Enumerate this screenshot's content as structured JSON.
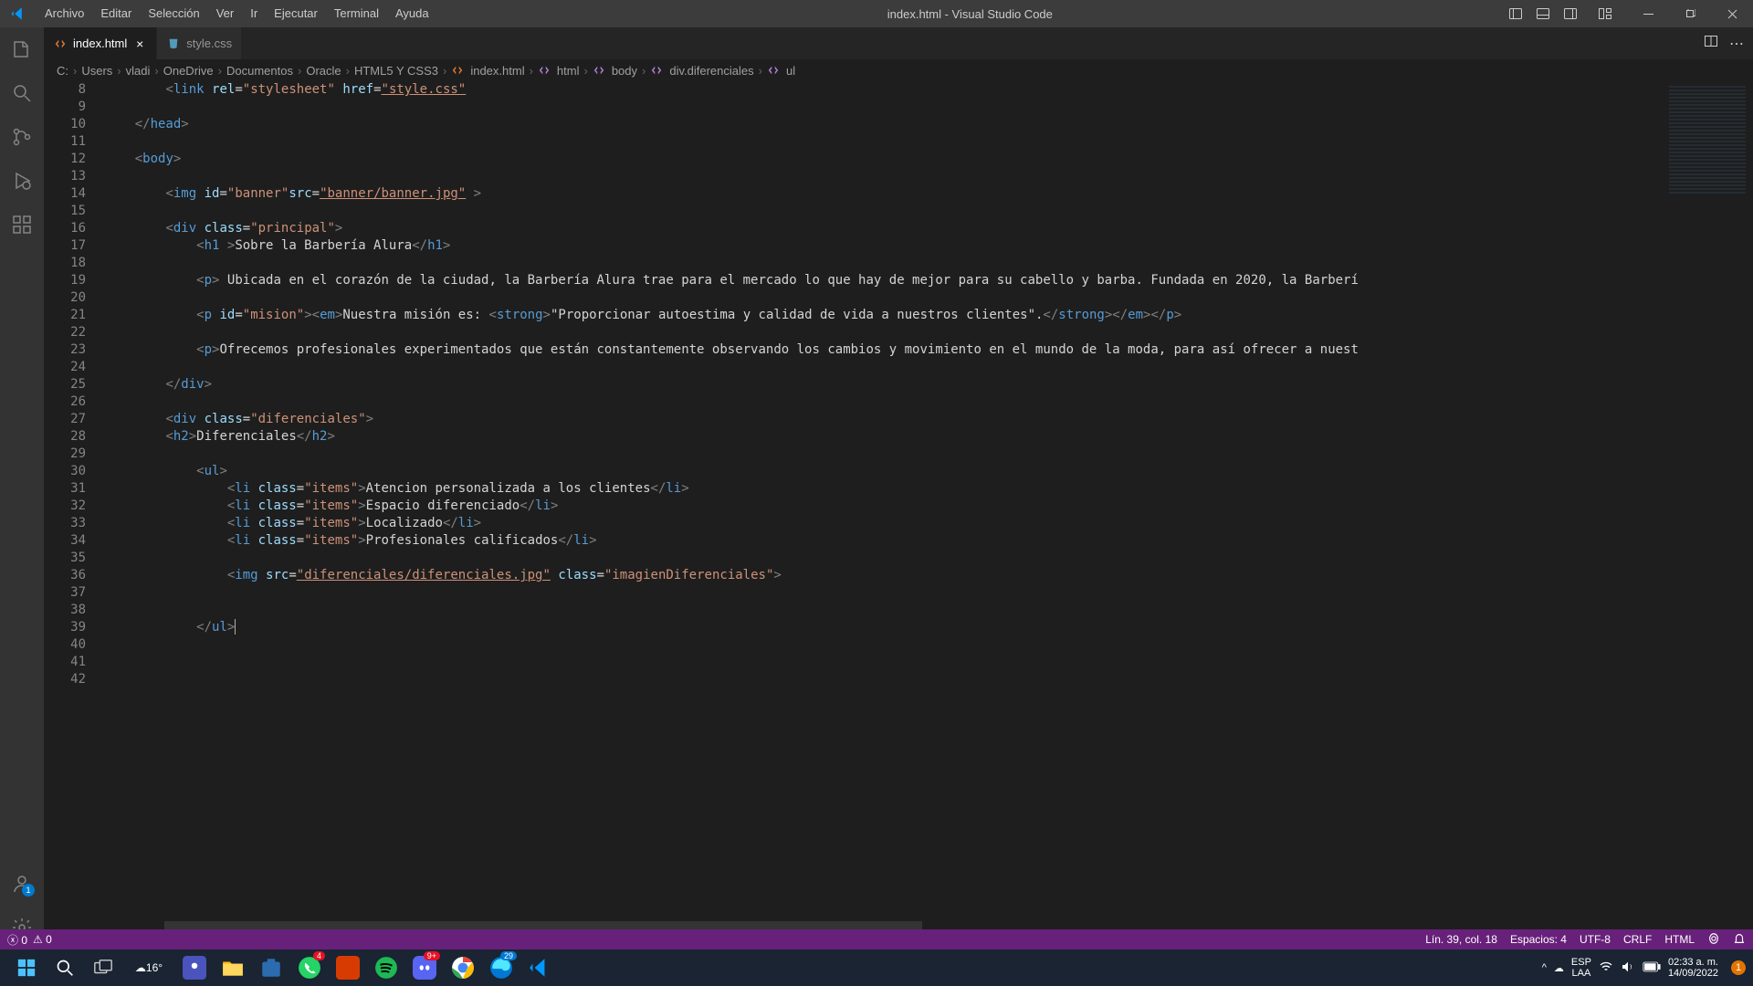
{
  "titlebar": {
    "title": "index.html - Visual Studio Code",
    "menu": [
      "Archivo",
      "Editar",
      "Selección",
      "Ver",
      "Ir",
      "Ejecutar",
      "Terminal",
      "Ayuda"
    ]
  },
  "tabs": [
    {
      "label": "index.html",
      "icon": "html",
      "active": true
    },
    {
      "label": "style.css",
      "icon": "css",
      "active": false
    }
  ],
  "breadcrumb": [
    {
      "label": "C:",
      "icon": ""
    },
    {
      "label": "Users",
      "icon": ""
    },
    {
      "label": "vladi",
      "icon": ""
    },
    {
      "label": "OneDrive",
      "icon": ""
    },
    {
      "label": "Documentos",
      "icon": ""
    },
    {
      "label": "Oracle",
      "icon": ""
    },
    {
      "label": "HTML5 Y CSS3",
      "icon": ""
    },
    {
      "label": "index.html",
      "icon": "file"
    },
    {
      "label": "html",
      "icon": "sym"
    },
    {
      "label": "body",
      "icon": "sym"
    },
    {
      "label": "div.diferenciales",
      "icon": "sym"
    },
    {
      "label": "ul",
      "icon": "sym"
    }
  ],
  "editor": {
    "first_line": 8,
    "lines": [
      "        <link rel=\"stylesheet\" href=\"style.css\"",
      "",
      "    </head>",
      "",
      "    <body>",
      "",
      "        <img id=\"banner\"src=\"banner/banner.jpg\" >",
      "",
      "        <div class=\"principal\">",
      "            <h1 >Sobre la Barbería Alura</h1>",
      "",
      "            <p> Ubicada en el corazón de la ciudad, la Barbería Alura trae para el mercado lo que hay de mejor para su cabello y barba. Fundada en 2020, la Barberí",
      "",
      "            <p id=\"mision\"><em>Nuestra misión es: <strong>\"Proporcionar autoestima y calidad de vida a nuestros clientes\".</strong></em></p>",
      "",
      "            <p>Ofrecemos profesionales experimentados que están constantemente observando los cambios y movimiento en el mundo de la moda, para así ofrecer a nuest",
      "",
      "        </div>",
      "",
      "        <div class=\"diferenciales\">",
      "        <h2>Diferenciales</h2>",
      "",
      "            <ul>",
      "                <li class=\"items\">Atencion personalizada a los clientes</li>",
      "                <li class=\"items\">Espacio diferenciado</li>",
      "                <li class=\"items\">Localizado</li>",
      "                <li class=\"items\">Profesionales calificados</li>",
      "",
      "                <img src=\"diferenciales/diferenciales.jpg\" class=\"imagienDiferenciales\">",
      "",
      "",
      "            </ul>",
      "",
      "",
      ""
    ]
  },
  "statusbar": {
    "errors": "0",
    "warnings": "0",
    "position": "Lín. 39, col. 18",
    "spaces": "Espacios: 4",
    "encoding": "UTF-8",
    "eol": "CRLF",
    "language": "HTML"
  },
  "taskbar": {
    "weather_temp": "16°",
    "lang1": "ESP",
    "lang2": "LAA",
    "time": "02:33 a. m.",
    "date": "14/09/2022",
    "notif": "1"
  }
}
